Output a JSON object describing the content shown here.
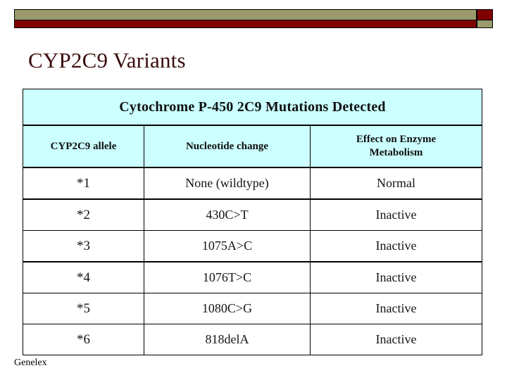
{
  "slide": {
    "title": "CYP2C9 Variants",
    "footer": "Genelex"
  },
  "decor": {
    "olive": "#9a9a6b",
    "maroon": "#800000",
    "title_color": "#3b0d0d",
    "table_header_bg": "#ccffff"
  },
  "table": {
    "caption": "Cytochrome P-450 2C9 Mutations Detected",
    "columns": [
      {
        "label": "CYP2C9 allele"
      },
      {
        "label": "Nucleotide change"
      },
      {
        "label_line1": "Effect on Enzyme",
        "label_line2": "Metabolism"
      }
    ],
    "rows": [
      {
        "allele": "*1",
        "change": "None (wildtype)",
        "effect": "Normal"
      },
      {
        "allele": "*2",
        "change": "430C>T",
        "effect": "Inactive"
      },
      {
        "allele": "*3",
        "change": "1075A>C",
        "effect": "Inactive"
      },
      {
        "allele": "*4",
        "change": "1076T>C",
        "effect": "Inactive"
      },
      {
        "allele": "*5",
        "change": "1080C>G",
        "effect": "Inactive"
      },
      {
        "allele": "*6",
        "change": "818delA",
        "effect": "Inactive"
      }
    ]
  }
}
